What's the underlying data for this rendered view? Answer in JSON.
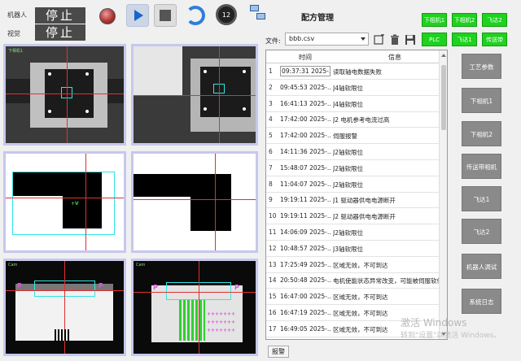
{
  "header": {
    "robot_label": "机器人",
    "vision_label": "视觉",
    "robot_state": "停止",
    "vision_state": "停止",
    "dial_value": "12"
  },
  "icons": {
    "record": "record-icon",
    "play": "play-icon",
    "stop": "stop-icon",
    "refresh": "refresh-icon",
    "dial": "dial-icon",
    "network": "network-icon",
    "new_file": "new-file-icon",
    "delete": "trash-icon",
    "save": "save-icon"
  },
  "title": "配方管理",
  "green_buttons": [
    "下相机1",
    "下相机2",
    "飞达2",
    "PLC",
    "飞达1",
    "传送带"
  ],
  "file": {
    "label": "文件:",
    "value": "bbb.csv"
  },
  "table": {
    "headers": {
      "time": "时间",
      "info": "信息"
    },
    "rows": [
      {
        "n": "1",
        "time": "09:37:31 2025-…",
        "info": "读取轴电数据失败"
      },
      {
        "n": "2",
        "time": "09:45:53 2025-…",
        "info": "J4轴软限位"
      },
      {
        "n": "3",
        "time": "16:41:13 2025-…",
        "info": "J4轴软限位"
      },
      {
        "n": "4",
        "time": "17:42:00 2025-…",
        "info": "J2 电机参考电流过高"
      },
      {
        "n": "5",
        "time": "17:42:00 2025-…",
        "info": "伺服报警"
      },
      {
        "n": "6",
        "time": "14:11:36 2025-…",
        "info": "J2轴软限位"
      },
      {
        "n": "7",
        "time": "15:48:07 2025-…",
        "info": "J2轴软限位"
      },
      {
        "n": "8",
        "time": "11:04:07 2025-…",
        "info": "J2轴软限位"
      },
      {
        "n": "9",
        "time": "19:19:11 2025-…",
        "info": "J1 驱动器供电电源断开"
      },
      {
        "n": "10",
        "time": "19:19:11 2025-…",
        "info": "J2 驱动器供电电源断开"
      },
      {
        "n": "11",
        "time": "14:06:09 2025-…",
        "info": "J2轴软限位"
      },
      {
        "n": "12",
        "time": "10:48:57 2025-…",
        "info": "J3轴软限位"
      },
      {
        "n": "13",
        "time": "17:25:49 2025-…",
        "info": "区域无效，不可到达"
      },
      {
        "n": "14",
        "time": "20:50:48 2025-…",
        "info": "电机使能状态异常改变，可能被伺服软件"
      },
      {
        "n": "15",
        "time": "16:47:00 2025-…",
        "info": "区域无效，不可到达"
      },
      {
        "n": "16",
        "time": "16:47:19 2025-…",
        "info": "区域无效，不可到达"
      },
      {
        "n": "17",
        "time": "16:49:05 2025-…",
        "info": "区域无效，不可到达"
      }
    ]
  },
  "alarm_button": "报警",
  "side_buttons": [
    "工艺参数",
    "下相机1",
    "下相机2",
    "传送带相机",
    "飞达1",
    "飞达2",
    "机器人调试",
    "系统日志"
  ],
  "cameras": [
    {
      "tag": "下相机1"
    },
    {
      "tag": ""
    },
    {
      "tag": ""
    },
    {
      "tag": ""
    },
    {
      "tag": "Cam"
    },
    {
      "tag": "Cam"
    }
  ],
  "watermark": {
    "line1": "激活 Windows",
    "line2": "转到\"设置\"以激活 Windows。"
  }
}
